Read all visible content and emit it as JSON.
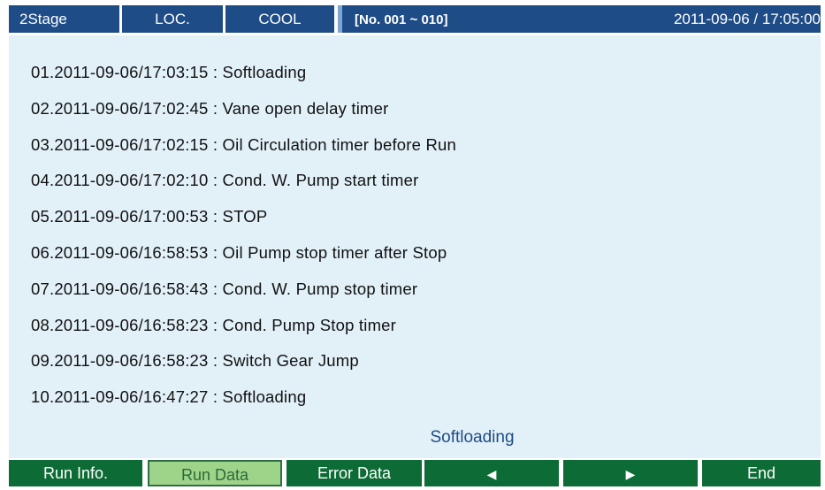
{
  "header": {
    "stage": "2Stage",
    "location": "LOC.",
    "mode": "COOL",
    "range": "[No. 001 ~ 010]",
    "datetime": "2011-09-06 / 17:05:00"
  },
  "log_entries": [
    "01.2011-09-06/17:03:15 : Softloading",
    "02.2011-09-06/17:02:45 : Vane open delay timer",
    "03.2011-09-06/17:02:15 : Oil Circulation timer before Run",
    "04.2011-09-06/17:02:10 : Cond. W. Pump start timer",
    "05.2011-09-06/17:00:53 : STOP",
    "06.2011-09-06/16:58:53 : Oil Pump stop timer after Stop",
    "07.2011-09-06/16:58:43 : Cond. W. Pump stop timer",
    "08.2011-09-06/16:58:23 : Cond. Pump Stop timer",
    "09.2011-09-06/16:58:23 : Switch Gear Jump",
    "10.2011-09-06/16:47:27 : Softloading"
  ],
  "status_text": "Softloading",
  "buttons": {
    "run_info": "Run Info.",
    "run_data": "Run Data",
    "error_data": "Error Data",
    "prev": "◀",
    "next": "▶",
    "end": "End"
  },
  "colors": {
    "header_bg": "#1e4c87",
    "screen_bg": "#e2f0f8",
    "button_bg": "#0d6b35",
    "button_active_bg": "#9ed48a"
  },
  "icons": {
    "prev": "left-triangle-icon",
    "next": "right-triangle-icon"
  }
}
